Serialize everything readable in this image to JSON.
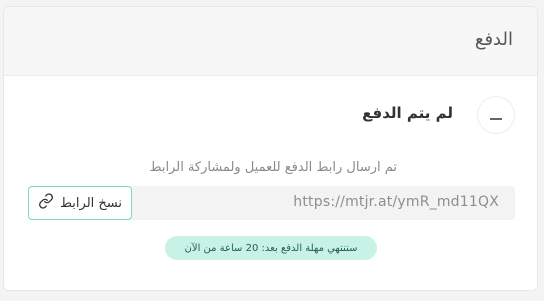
{
  "section": {
    "title": "الدفع"
  },
  "payment_status": {
    "icon": "minus-icon",
    "title": "لم يتم الدفع",
    "helper_text": "تم ارسال رابط الدفع للعميل ولمشاركة الرابط"
  },
  "payment_link": {
    "url": "https://mtjr.at/ymR_md11QX",
    "copy_button_label": "نسخ الرابط",
    "copy_icon": "link-icon"
  },
  "deadline_badge": {
    "text": "ستنتهي مهلة الدفع بعد: 20 ساعة من الآن"
  },
  "colors": {
    "accent_border": "#7ad9c9",
    "badge_bg": "#c9f2e7",
    "badge_text": "#1f5f52"
  }
}
